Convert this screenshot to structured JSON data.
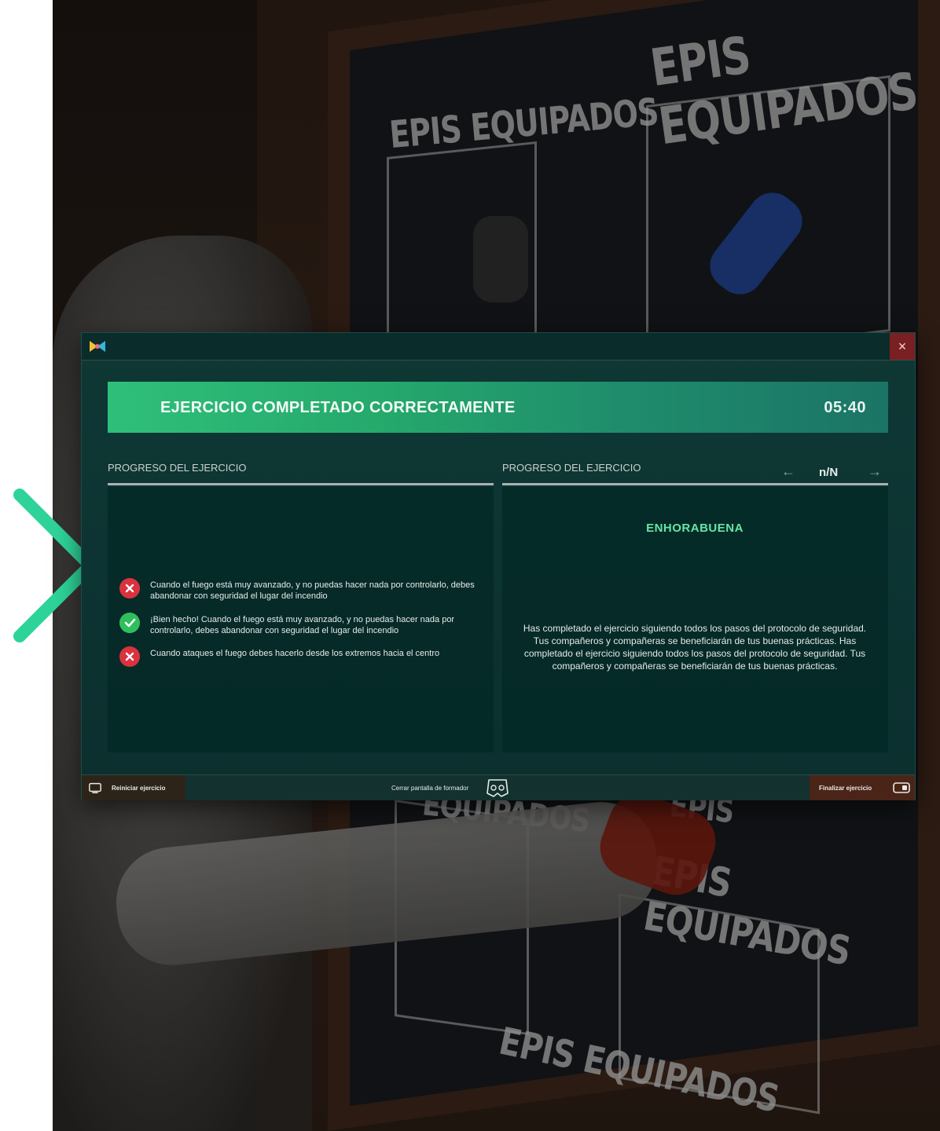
{
  "background": {
    "signs": [
      "EPIS EQUIPADOS",
      "EPIS EQUIPADOS",
      "EQUIPADOS",
      "EPIS",
      "EPIS EQUIPADOS",
      "EPIS EQUIPADOS"
    ]
  },
  "window": {
    "close_label": "×",
    "banner": {
      "title": "EJERCICIO COMPLETADO CORRECTAMENTE",
      "timer": "05:40"
    },
    "left_panel": {
      "heading": "PROGRESO DEL EJERCICIO",
      "items": [
        {
          "status": "fail",
          "text": "Cuando el fuego está muy avanzado, y no puedas hacer nada por controlarlo, debes abandonar con seguridad el lugar del incendio"
        },
        {
          "status": "ok",
          "text": "¡Bien hecho! Cuando el fuego está muy avanzado, y no puedas hacer nada por controlarlo, debes abandonar con seguridad el lugar del incendio"
        },
        {
          "status": "fail",
          "text": "Cuando ataques el fuego debes hacerlo desde los extremos hacia el centro"
        }
      ]
    },
    "right_panel": {
      "heading": "PROGRESO DEL EJERCICIO",
      "prev_label": "←",
      "page": "n/N",
      "next_label": "→",
      "congrats": "ENHORABUENA",
      "body": "Has completado el ejercicio siguiendo todos los pasos del protocolo de seguridad. Tus compañeros y compañeras se beneficiarán de tus buenas prácticas. Has completado el ejercicio siguiendo todos los pasos del protocolo de seguridad. Tus compañeros y compañeras se beneficiarán de tus buenas prácticas."
    },
    "footer": {
      "restart_label": "Reiniciar ejercicio",
      "close_trainer_label": "Cerrar pantalla de formador",
      "finish_label": "Finalizar ejercicio"
    }
  },
  "colors": {
    "accent_green": "#2fbf7a",
    "fail_red": "#d8333f",
    "ok_green": "#2fbf5e",
    "chevron": "#2ed39a"
  }
}
